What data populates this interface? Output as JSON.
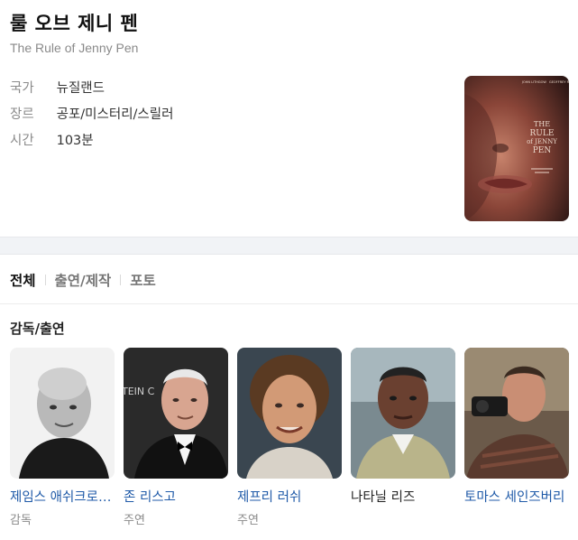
{
  "movie": {
    "title": "룰 오브 제니 펜",
    "original_title": "The Rule of Jenny Pen",
    "info": [
      {
        "key": "국가",
        "value": "뉴질랜드"
      },
      {
        "key": "장르",
        "value": "공포/미스터리/스릴러"
      },
      {
        "key": "시간",
        "value": "103분"
      }
    ],
    "poster": {
      "icon": "movie-poster-image",
      "title_text": "THE RULE OF JENNY PEN",
      "names": [
        "JOHN LITHGOW",
        "GEOFFREY RUSH"
      ]
    }
  },
  "tabs": [
    {
      "label": "전체",
      "active": true
    },
    {
      "label": "출연/제작",
      "active": false
    },
    {
      "label": "포토",
      "active": false
    }
  ],
  "section": {
    "title": "감독/출연"
  },
  "people": [
    {
      "name": "제임스 애쉬크로프트",
      "role": "감독",
      "linked": true
    },
    {
      "name": "존 리스고",
      "role": "주연",
      "linked": true,
      "backdrop_text": "TEIN C"
    },
    {
      "name": "제프리 러쉬",
      "role": "주연",
      "linked": true
    },
    {
      "name": "나타닐 리즈",
      "role": "",
      "linked": false
    },
    {
      "name": "토마스 세인즈버리",
      "role": "",
      "linked": true
    }
  ],
  "colors": {
    "link": "#1f5aa8",
    "muted": "#8a8a8a",
    "band": "#f1f3f6"
  }
}
